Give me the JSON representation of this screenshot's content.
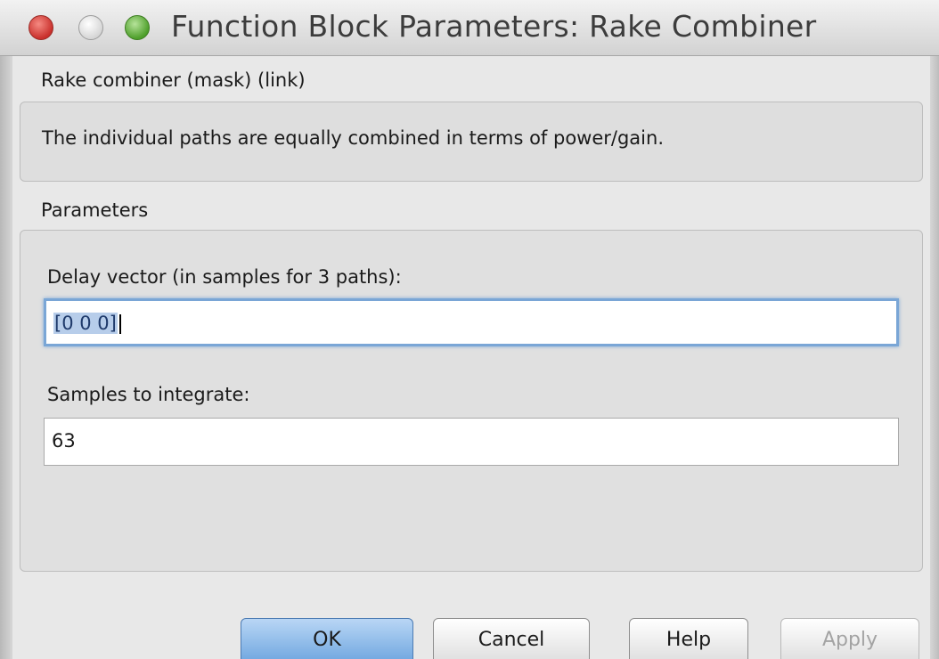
{
  "window": {
    "title": "Function Block Parameters: Rake Combiner",
    "controls": {
      "close_color": "#c9302c",
      "minimize_color": "#d3d3d3",
      "maximize_color": "#4e9f2b"
    }
  },
  "block": {
    "name": "Rake combiner (mask) (link)",
    "description": "The individual paths are equally combined in terms of power/gain."
  },
  "parameters": {
    "section_label": "Parameters",
    "delay_vector": {
      "label": "Delay vector (in samples for 3 paths):",
      "value": "[0 0 0]"
    },
    "samples_to_integrate": {
      "label": "Samples to integrate:",
      "value": "63"
    }
  },
  "buttons": {
    "ok": "OK",
    "cancel": "Cancel",
    "help": "Help",
    "apply": "Apply"
  }
}
